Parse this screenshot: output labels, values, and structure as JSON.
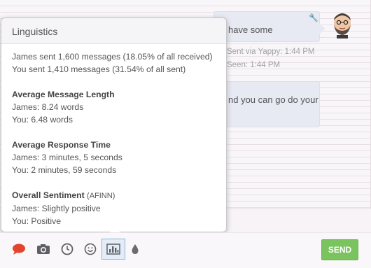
{
  "chat": {
    "messages": [
      {
        "text": "have some"
      },
      {
        "text": "nd you can go do your"
      }
    ],
    "meta": {
      "sent": "Sent via Yappy: 1:44 PM",
      "seen": "Seen: 1:44 PM"
    }
  },
  "popover": {
    "title": "Linguistics",
    "summary": [
      "James sent 1,600 messages (18.05% of all received)",
      "You sent 1,410 messages (31.54% of all sent)"
    ],
    "sections": [
      {
        "heading": "Average Message Length",
        "sub": "",
        "lines": [
          "James: 8.24 words",
          "You: 6.48 words"
        ]
      },
      {
        "heading": "Average Response Time",
        "sub": "",
        "lines": [
          "James: 3 minutes, 5 seconds",
          "You: 2 minutes, 59 seconds"
        ]
      },
      {
        "heading": "Overall Sentiment",
        "sub": "(AFINN)",
        "lines": [
          "James: Slightly positive",
          "You: Positive"
        ]
      }
    ]
  },
  "toolbar": {
    "icons": [
      "speech-bubble-icon",
      "camera-icon",
      "clock-icon",
      "smiley-icon",
      "bar-chart-icon",
      "drop-icon"
    ],
    "send_label": "SEND"
  },
  "colors": {
    "accent_green": "#7ac35f",
    "bubble": "#e7e9f3",
    "chat_icon_red": "#e2452c",
    "selected_tool_border": "#8fb3d8"
  }
}
